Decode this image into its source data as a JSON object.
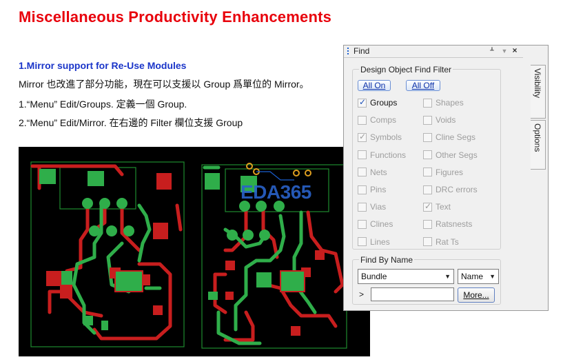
{
  "page": {
    "title": "Miscellaneous Productivity Enhancements",
    "section_heading": "1.Mirror support for Re-Use Modules",
    "lines": [
      "Mirror 也改進了部分功能，現在可以支援以 Group 爲單位的 Mirror。",
      "1.“Menu” Edit/Groups.  定義一個 Group.",
      "2.“Menu” Edit/Mirror.  在右邊的 Filter 欄位支援 Group"
    ],
    "watermark": "EDA365"
  },
  "colors": {
    "title_red": "#e8000b",
    "heading_blue": "#1a35c9",
    "pcb_green": "#2fae4a",
    "pcb_red": "#c81e1e",
    "pcb_outline": "#1f8c2f",
    "pcb_pad": "#e0a020"
  },
  "find_panel": {
    "title": "Find",
    "icons": {
      "pin": "pin-icon",
      "dropdown": "dropdown-icon",
      "close": "close-icon"
    },
    "filter_group_label": "Design Object Find Filter",
    "all_on_label": "All On",
    "all_off_label": "All Off",
    "checkboxes": [
      {
        "label": "Groups",
        "checked": true,
        "enabled": true
      },
      {
        "label": "Shapes",
        "checked": false,
        "enabled": false
      },
      {
        "label": "Comps",
        "checked": false,
        "enabled": false
      },
      {
        "label": "Voids",
        "checked": false,
        "enabled": false
      },
      {
        "label": "Symbols",
        "checked": true,
        "enabled": false
      },
      {
        "label": "Cline Segs",
        "checked": false,
        "enabled": false
      },
      {
        "label": "Functions",
        "checked": false,
        "enabled": false
      },
      {
        "label": "Other Segs",
        "checked": false,
        "enabled": false
      },
      {
        "label": "Nets",
        "checked": false,
        "enabled": false
      },
      {
        "label": "Figures",
        "checked": false,
        "enabled": false
      },
      {
        "label": "Pins",
        "checked": false,
        "enabled": false
      },
      {
        "label": "DRC errors",
        "checked": false,
        "enabled": false
      },
      {
        "label": "Vias",
        "checked": false,
        "enabled": false
      },
      {
        "label": "Text",
        "checked": true,
        "enabled": false
      },
      {
        "label": "Clines",
        "checked": false,
        "enabled": false
      },
      {
        "label": "Ratsnests",
        "checked": false,
        "enabled": false
      },
      {
        "label": "Lines",
        "checked": false,
        "enabled": false
      },
      {
        "label": "Rat Ts",
        "checked": false,
        "enabled": false
      }
    ],
    "side_tabs": [
      "Visibility",
      "Options"
    ],
    "find_by_name_label": "Find By Name",
    "type_select": "Bundle",
    "name_select": "Name",
    "prompt": ">",
    "name_input_value": "",
    "more_button": "More..."
  }
}
